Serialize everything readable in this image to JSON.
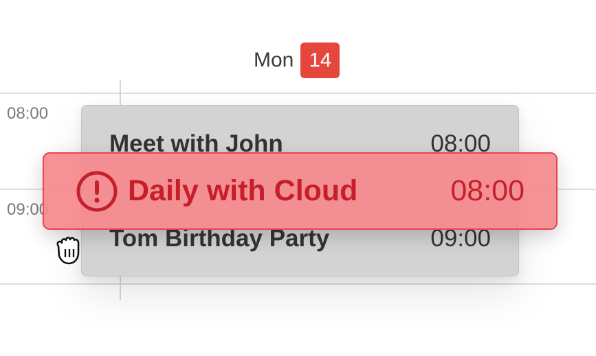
{
  "day_header": {
    "day_name": "Mon",
    "day_number": "14"
  },
  "time_labels": [
    "08:00",
    "09:00"
  ],
  "event_group": {
    "events": [
      {
        "title": "Meet with John",
        "time": "08:00"
      },
      {
        "title": "Tom Birthday Party",
        "time": "09:00"
      }
    ]
  },
  "dragged_event": {
    "title": "Daily with Cloud",
    "time": "08:00",
    "icon": "alert-circle-icon"
  },
  "cursor": {
    "icon": "grab-hand-icon"
  },
  "colors": {
    "accent_red": "#e5473d",
    "alert_background": "#f58a8e",
    "alert_text": "#c61f2a",
    "event_background": "#d3d3d3"
  }
}
